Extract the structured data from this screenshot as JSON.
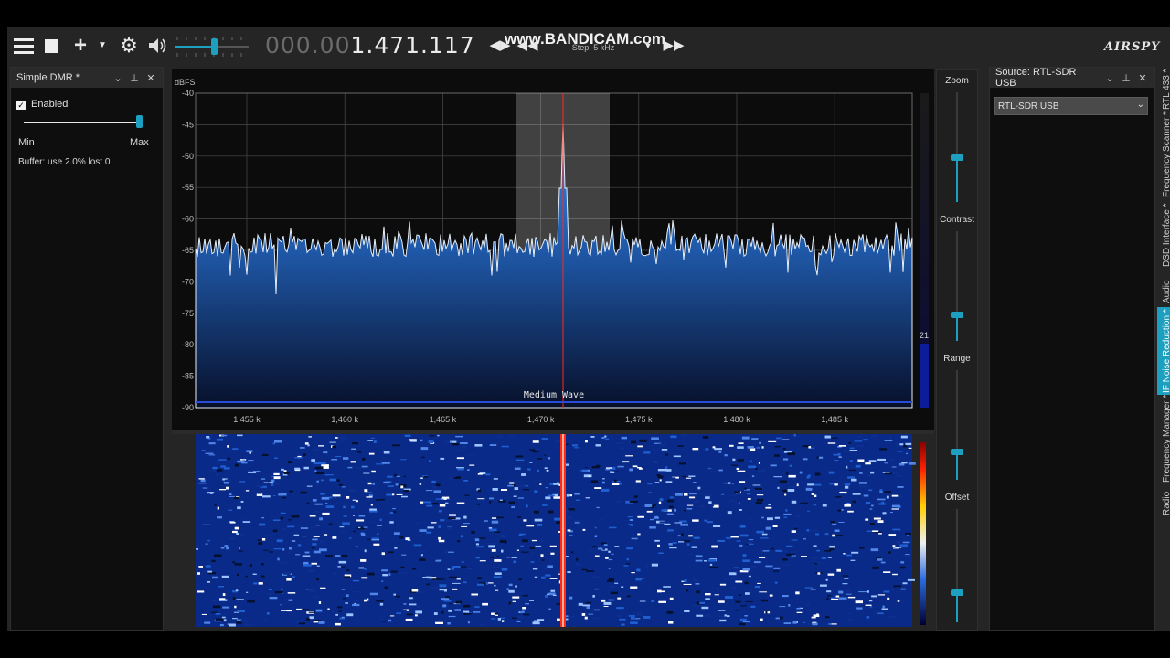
{
  "toolbar": {
    "frequency_dim": "000.00",
    "frequency_bright": "1.471.117",
    "watermark": "www.BANDICAM.com",
    "step_label": "Step: 5 kHz",
    "brand": "AIRSPY"
  },
  "left_panel": {
    "title": "Simple DMR *",
    "enabled_label": "Enabled",
    "slider_min": "Min",
    "slider_max": "Max",
    "slider_value": 0.98,
    "buffer_text": "Buffer: use 2.0% lost 0"
  },
  "spectrum": {
    "unit_label": "dBFS",
    "y_ticks": [
      "-40",
      "-45",
      "-50",
      "-55",
      "-60",
      "-65",
      "-70",
      "-75",
      "-80",
      "-85",
      "-90"
    ],
    "x_ticks": [
      "1,455 k",
      "1,460 k",
      "1,465 k",
      "1,470 k",
      "1,475 k",
      "1,480 k",
      "1,485 k"
    ],
    "band_label": "Medium Wave",
    "side_value": "21"
  },
  "controls": {
    "zoom_label": "Zoom",
    "contrast_label": "Contrast",
    "range_label": "Range",
    "offset_label": "Offset"
  },
  "right_panel": {
    "title": "Source: RTL-SDR USB",
    "source_value": "RTL-SDR USB"
  },
  "side_tabs": [
    "RTL 433 *",
    "Frequency Scanner *",
    "DSD Interface *",
    "Audio",
    "IF Noise Reduction *",
    "Frequency Manager *",
    "Radio"
  ],
  "colors": {
    "accent": "#1d9fbf",
    "spectrum_fill": "#2a72c6",
    "carrier": "#ff2a1a"
  }
}
